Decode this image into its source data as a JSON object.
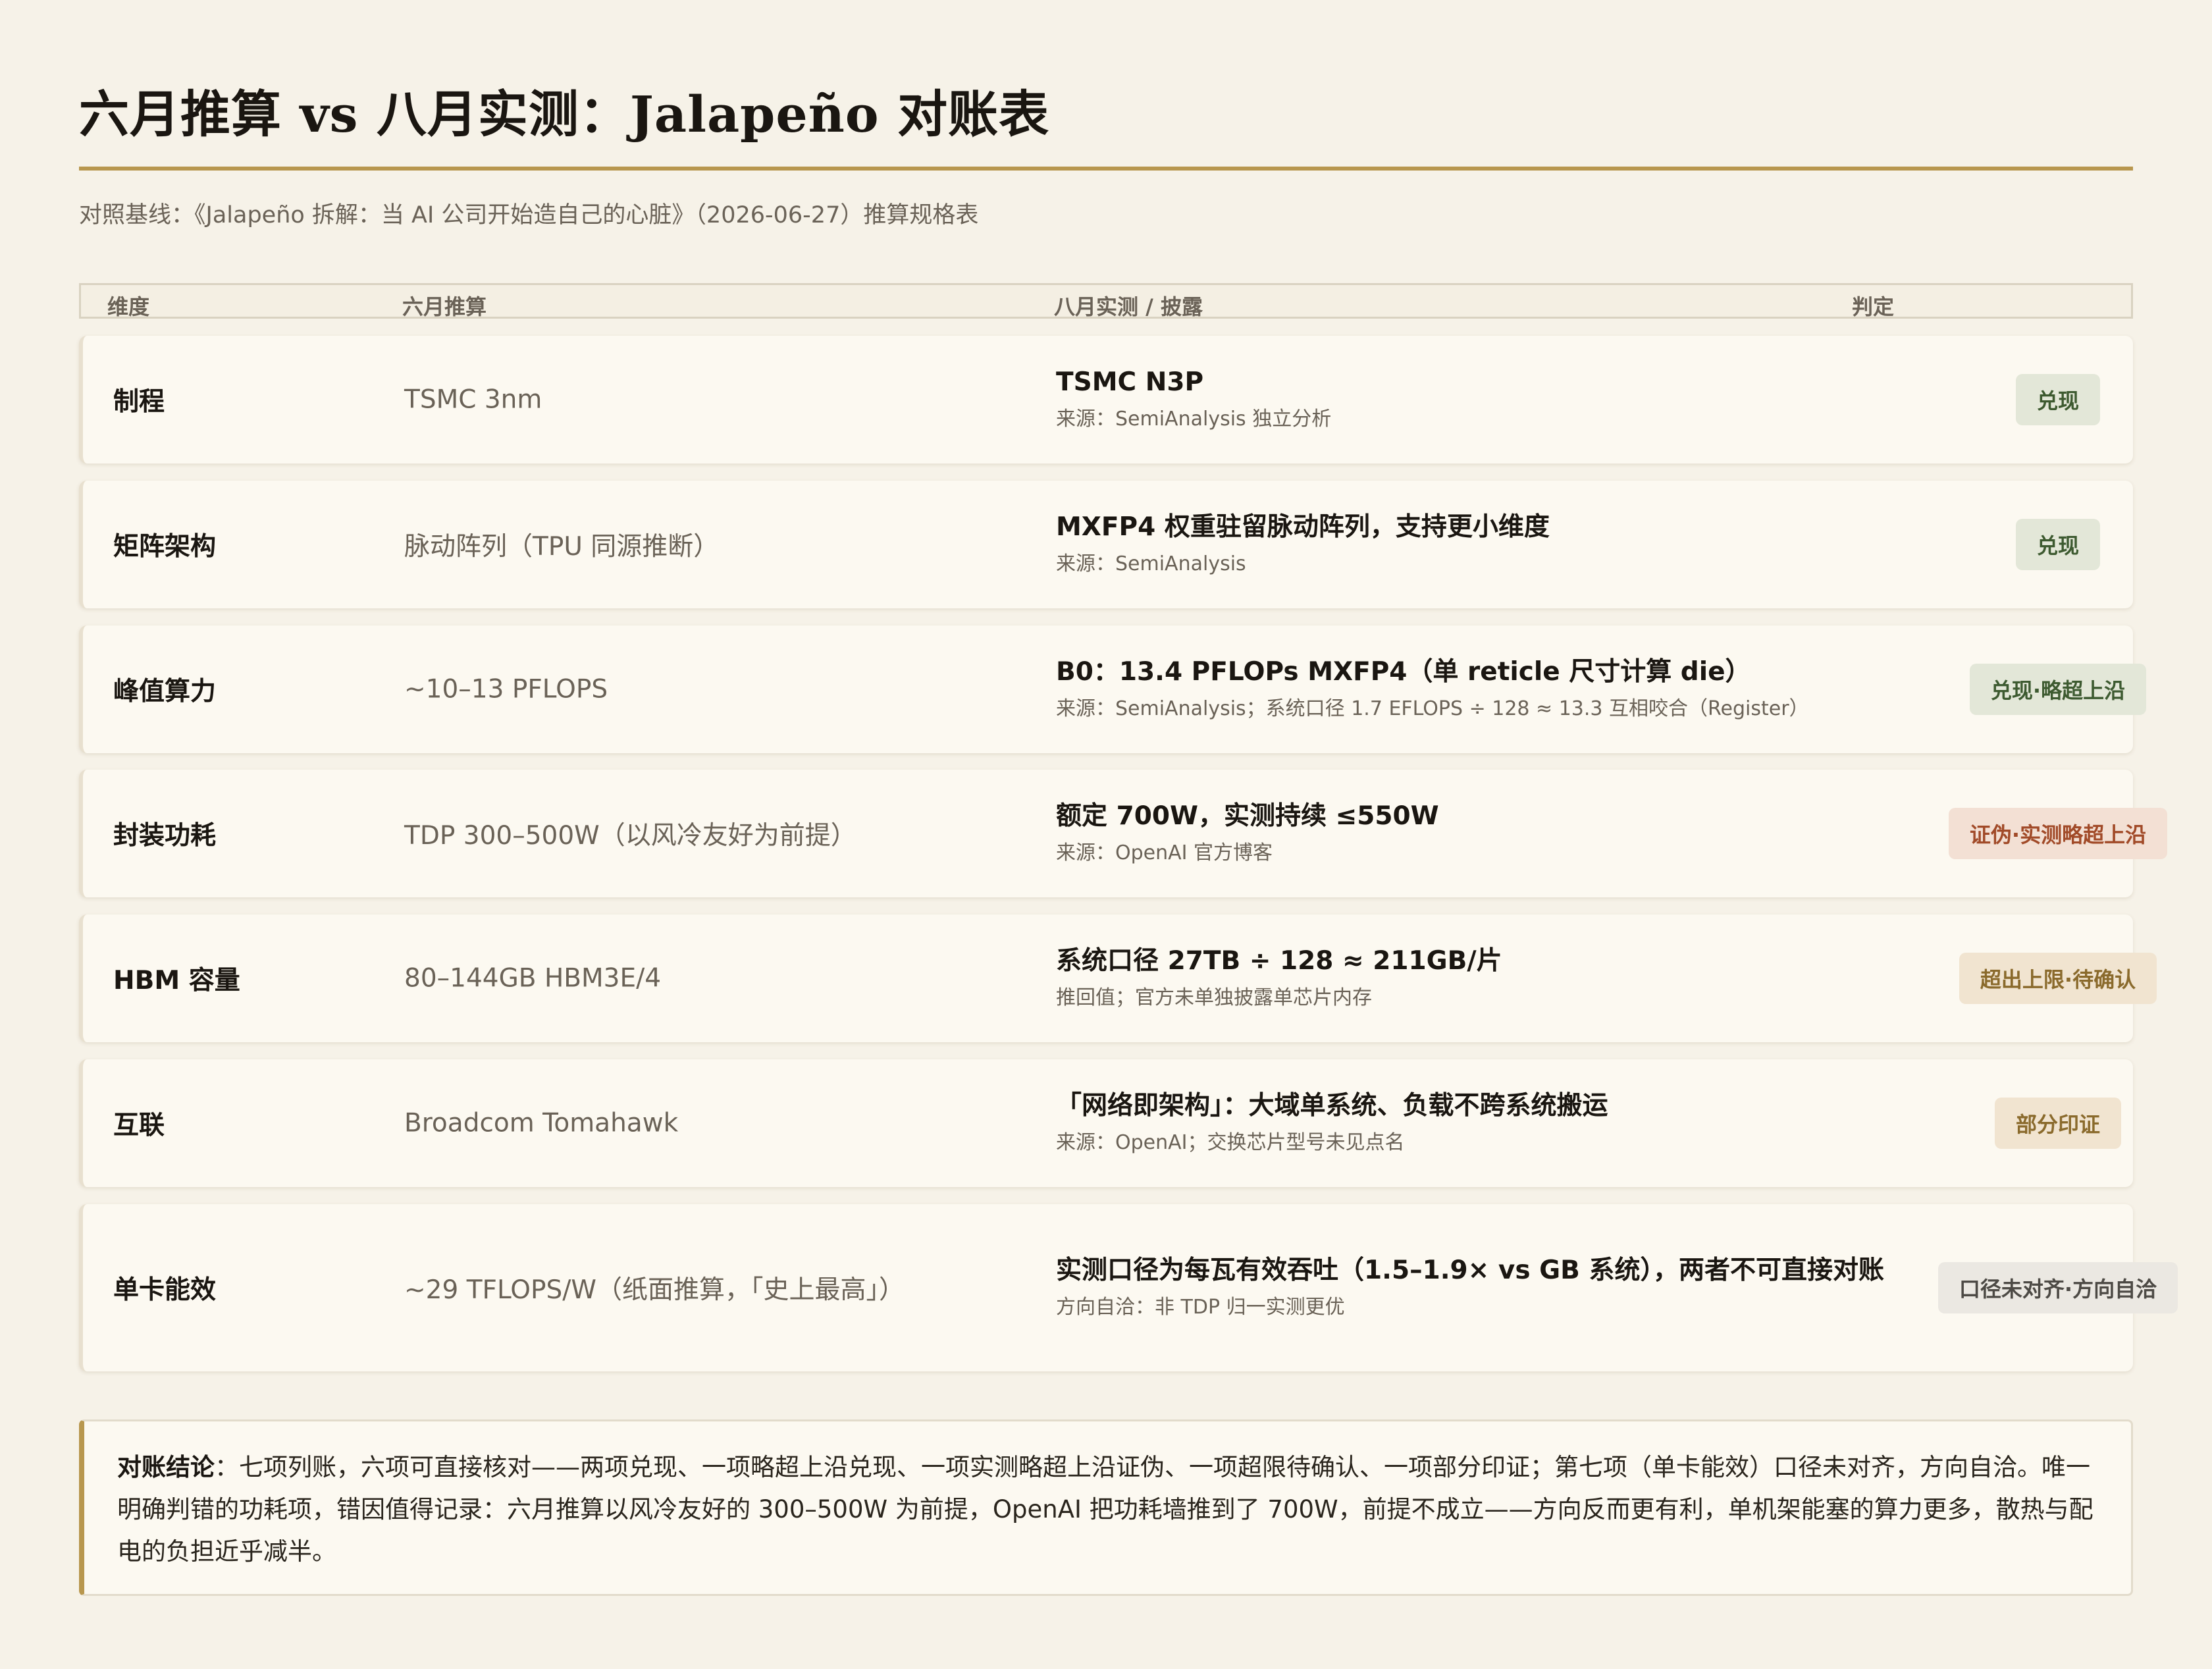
{
  "title": "六月推算 vs 八月实测：Jalapeño 对账表",
  "baseline": "对照基线：《Jalapeño 拆解：当 AI 公司开始造自己的心脏》（2026-06-27）推算规格表",
  "table": {
    "headers": [
      "维度",
      "六月推算",
      "八月实测 / 披露",
      "判定"
    ],
    "rows": [
      {
        "dimension": "制程",
        "june": "TSMC 3nm",
        "august": "TSMC N3P",
        "source": "来源：SemiAnalysis 独立分析",
        "verdict": "兑现",
        "verdict_tone": "green"
      },
      {
        "dimension": "矩阵架构",
        "june": "脉动阵列（TPU 同源推断）",
        "august": "MXFP4 权重驻留脉动阵列，支持更小维度",
        "source": "来源：SemiAnalysis",
        "verdict": "兑现",
        "verdict_tone": "green"
      },
      {
        "dimension": "峰值算力",
        "june": "~10–13 PFLOPS",
        "august": "B0：13.4 PFLOPs MXFP4（单 reticle 尺寸计算 die）",
        "source": "来源：SemiAnalysis；系统口径 1.7 EFLOPS ÷ 128 ≈ 13.3 互相咬合（Register）",
        "verdict": "兑现·略超上沿",
        "verdict_tone": "green"
      },
      {
        "dimension": "封装功耗",
        "june": "TDP 300–500W（以风冷友好为前提）",
        "august": "额定 700W，实测持续 ≤550W",
        "source": "来源：OpenAI 官方博客",
        "verdict": "证伪·实测略超上沿",
        "verdict_tone": "red"
      },
      {
        "dimension": "HBM 容量",
        "june": "80–144GB HBM3E/4",
        "august": "系统口径 27TB ÷ 128 ≈ 211GB/片",
        "source": "推回值；官方未单独披露单芯片内存",
        "verdict": "超出上限·待确认",
        "verdict_tone": "amber"
      },
      {
        "dimension": "互联",
        "june": "Broadcom Tomahawk",
        "august": "「网络即架构」：大域单系统、负载不跨系统搬运",
        "source": "来源：OpenAI；交换芯片型号未见点名",
        "verdict": "部分印证",
        "verdict_tone": "amber"
      },
      {
        "dimension": "单卡能效",
        "june": "~29 TFLOPS/W（纸面推算，「史上最高」）",
        "august": "实测口径为每瓦有效吞吐（1.5–1.9× vs GB 系统），两者不可直接对账",
        "source": "方向自洽：非 TDP 归一实测更优",
        "verdict": "口径未对齐·方向自洽",
        "verdict_tone": "grey"
      }
    ]
  },
  "conclusion": {
    "label": "对账结论",
    "text": "：七项列账，六项可直接核对——两项兑现、一项略超上沿兑现、一项实测略超上沿证伪、一项超限待确认、一项部分印证；第七项（单卡能效）口径未对齐，方向自洽。唯一明确判错的功耗项，错因值得记录：六月推算以风冷友好的 300–500W 为前提，OpenAI 把功耗墙推到了 700W，前提不成立——方向反而更有利，单机架能塞的算力更多，散热与配电的负担近乎减半。"
  },
  "colors": {
    "accent": "#b8974e",
    "background": "#f6f2e8",
    "green_badge": "#e3e7d8",
    "red_badge": "#f3e0d4",
    "amber_badge": "#f1e4d0",
    "grey_badge": "#ebe8e2"
  }
}
